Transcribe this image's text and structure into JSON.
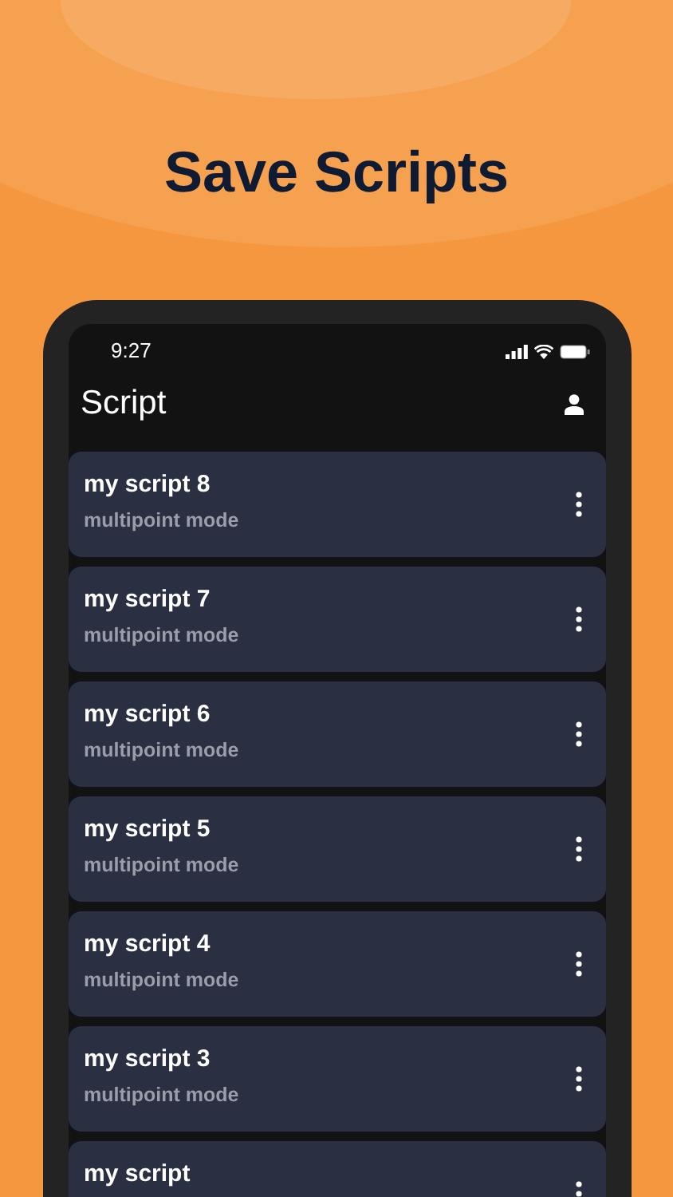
{
  "headline": "Save Scripts",
  "status_bar": {
    "time": "9:27"
  },
  "app_bar": {
    "title": "Script"
  },
  "scripts": [
    {
      "name": "my script 8",
      "mode": "multipoint mode"
    },
    {
      "name": "my script 7",
      "mode": "multipoint mode"
    },
    {
      "name": "my script 6",
      "mode": "multipoint mode"
    },
    {
      "name": "my script 5",
      "mode": "multipoint mode"
    },
    {
      "name": "my script 4",
      "mode": "multipoint mode"
    },
    {
      "name": "my script 3",
      "mode": "multipoint mode"
    },
    {
      "name": "my script"
    }
  ]
}
